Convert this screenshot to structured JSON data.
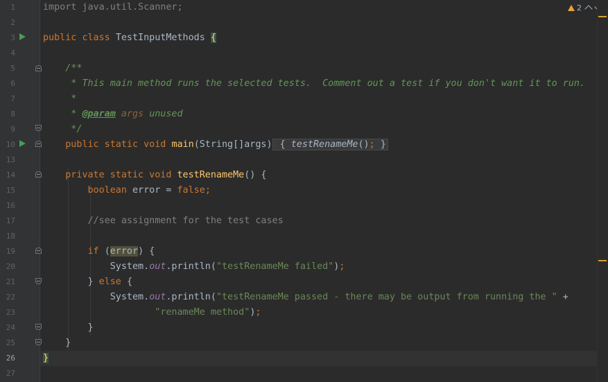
{
  "inspection": {
    "warning_count": "2"
  },
  "lines": [
    {
      "n": "1"
    },
    {
      "n": "2"
    },
    {
      "n": "3"
    },
    {
      "n": "4"
    },
    {
      "n": "5"
    },
    {
      "n": "6"
    },
    {
      "n": "7"
    },
    {
      "n": "8"
    },
    {
      "n": "9"
    },
    {
      "n": "10"
    },
    {
      "n": "13"
    },
    {
      "n": "14"
    },
    {
      "n": "15"
    },
    {
      "n": "16"
    },
    {
      "n": "17"
    },
    {
      "n": "18"
    },
    {
      "n": "19"
    },
    {
      "n": "20"
    },
    {
      "n": "21"
    },
    {
      "n": "22"
    },
    {
      "n": "23"
    },
    {
      "n": "24"
    },
    {
      "n": "25"
    },
    {
      "n": "26"
    },
    {
      "n": "27"
    }
  ],
  "code": {
    "l1": {
      "import": "import java.util.Scanner;"
    },
    "l3": {
      "public": "public",
      "class": "class",
      "name": "TestInputMethods",
      "brace": "{"
    },
    "l5": {
      "text": "/**"
    },
    "l6": {
      "text": " * This main method runs the selected tests.  Comment out a test if you don't want it to run."
    },
    "l7": {
      "text": " *"
    },
    "l8": {
      "star": " * ",
      "tag": "@param",
      "param": "args",
      "desc": "unused"
    },
    "l9": {
      "text": " */"
    },
    "l10": {
      "mods": "public static void",
      "name": "main",
      "sig": "(String[]args)",
      "body_open": "{",
      "call": "testRenameMe",
      "call_rest": "()",
      "semi": ";",
      "body_close": "}"
    },
    "l14": {
      "mods": "private static void",
      "name": "testRenameMe",
      "rest": "() {"
    },
    "l15": {
      "type": "boolean",
      "var": "error =",
      "val": "false",
      "semi": ";"
    },
    "l17": {
      "comment": "//see assignment for the test cases"
    },
    "l19": {
      "kw": "if",
      "open": "(",
      "var": "error",
      "close": ") {"
    },
    "l20": {
      "sys": "System.",
      "out": "out",
      "call": ".println(",
      "str": "\"testRenameMe failed\"",
      "end": ")",
      "semi": ";"
    },
    "l21": {
      "close": "}",
      "kw": "else",
      "open": "{"
    },
    "l22": {
      "sys": "System.",
      "out": "out",
      "call": ".println(",
      "str": "\"testRenameMe passed - there may be output from running the \"",
      "plus": "+"
    },
    "l23": {
      "str": "\"renameMe method\"",
      "end": ")",
      "semi": ";"
    },
    "l24": {
      "close": "}"
    },
    "l25": {
      "close": "}"
    },
    "l26": {
      "close": "}"
    }
  }
}
